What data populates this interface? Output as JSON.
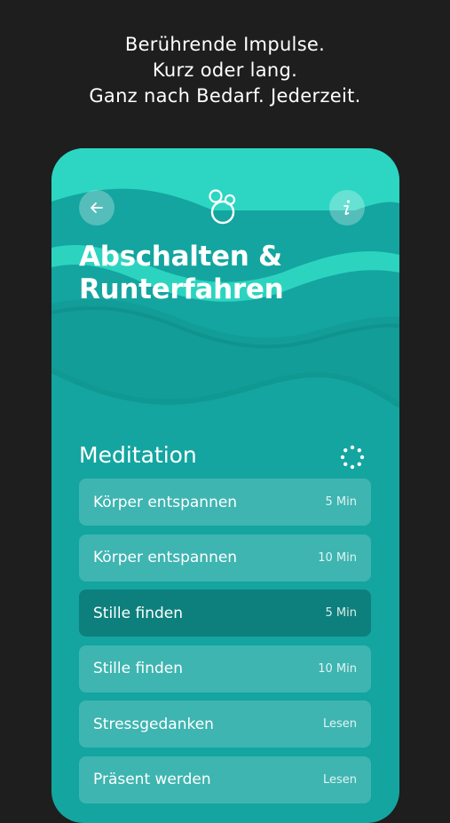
{
  "promo": {
    "lines": [
      "Berührende Impulse.",
      "Kurz oder lang.",
      "Ganz nach Bedarf. Jederzeit."
    ]
  },
  "app": {
    "header": {
      "back_icon": "arrow-left-icon",
      "logo_icon": "bubbles-logo-icon",
      "info_icon": "info-icon"
    },
    "title_lines": [
      "Abschalten &",
      "Runterfahren"
    ],
    "section": {
      "title": "Meditation",
      "action_icon": "dotted-circle-loader-icon"
    },
    "items": [
      {
        "label": "Körper entspannen",
        "meta": "5 Min",
        "active": false
      },
      {
        "label": "Körper entspannen",
        "meta": "10 Min",
        "active": false
      },
      {
        "label": "Stille finden",
        "meta": "5 Min",
        "active": true
      },
      {
        "label": "Stille finden",
        "meta": "10 Min",
        "active": false
      },
      {
        "label": "Stressgedanken",
        "meta": "Lesen",
        "active": false
      },
      {
        "label": "Präsent werden",
        "meta": "Lesen",
        "active": false
      }
    ]
  },
  "colors": {
    "background": "#1e1e1e",
    "teal": "#14a5a0",
    "wave_light": "#2dd6c2",
    "wave_dark": "#0f8f8b"
  }
}
